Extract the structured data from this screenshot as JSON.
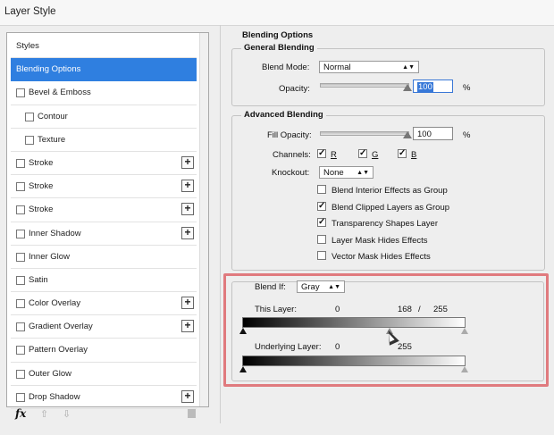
{
  "window": {
    "title": "Layer Style"
  },
  "sidebar": {
    "items": [
      {
        "label": "Styles",
        "checkbox": false,
        "selected": false,
        "indent": 0,
        "plus": false
      },
      {
        "label": "Blending Options",
        "checkbox": false,
        "selected": true,
        "indent": 0,
        "plus": false
      },
      {
        "label": "Bevel & Emboss",
        "checkbox": true,
        "selected": false,
        "indent": 0,
        "plus": false
      },
      {
        "label": "Contour",
        "checkbox": true,
        "selected": false,
        "indent": 1,
        "plus": false
      },
      {
        "label": "Texture",
        "checkbox": true,
        "selected": false,
        "indent": 1,
        "plus": false
      },
      {
        "label": "Stroke",
        "checkbox": true,
        "selected": false,
        "indent": 0,
        "plus": true
      },
      {
        "label": "Stroke",
        "checkbox": true,
        "selected": false,
        "indent": 0,
        "plus": true
      },
      {
        "label": "Stroke",
        "checkbox": true,
        "selected": false,
        "indent": 0,
        "plus": true
      },
      {
        "label": "Inner Shadow",
        "checkbox": true,
        "selected": false,
        "indent": 0,
        "plus": true
      },
      {
        "label": "Inner Glow",
        "checkbox": true,
        "selected": false,
        "indent": 0,
        "plus": false
      },
      {
        "label": "Satin",
        "checkbox": true,
        "selected": false,
        "indent": 0,
        "plus": false
      },
      {
        "label": "Color Overlay",
        "checkbox": true,
        "selected": false,
        "indent": 0,
        "plus": true
      },
      {
        "label": "Gradient Overlay",
        "checkbox": true,
        "selected": false,
        "indent": 0,
        "plus": true
      },
      {
        "label": "Pattern Overlay",
        "checkbox": true,
        "selected": false,
        "indent": 0,
        "plus": false
      },
      {
        "label": "Outer Glow",
        "checkbox": true,
        "selected": false,
        "indent": 0,
        "plus": false
      },
      {
        "label": "Drop Shadow",
        "checkbox": true,
        "selected": false,
        "indent": 0,
        "plus": true
      }
    ],
    "plus_glyph": "+",
    "bottom": {
      "fx": "fx",
      "up_arrow": "⇧",
      "down_arrow": "⇩"
    }
  },
  "blending": {
    "heading": "Blending Options",
    "general": {
      "title": "General Blending",
      "blend_mode_label": "Blend Mode:",
      "blend_mode_value": "Normal",
      "opacity_label": "Opacity:",
      "opacity_value": "100",
      "opacity_unit": "%"
    },
    "advanced": {
      "title": "Advanced Blending",
      "fill_opacity_label": "Fill Opacity:",
      "fill_opacity_value": "100",
      "fill_opacity_unit": "%",
      "channels_label": "Channels:",
      "channel_r": "R",
      "channel_g": "G",
      "channel_b": "B",
      "knockout_label": "Knockout:",
      "knockout_value": "None",
      "options": [
        {
          "label": "Blend Interior Effects as Group",
          "checked": false
        },
        {
          "label": "Blend Clipped Layers as Group",
          "checked": true
        },
        {
          "label": "Transparency Shapes Layer",
          "checked": true
        },
        {
          "label": "Layer Mask Hides Effects",
          "checked": false
        },
        {
          "label": "Vector Mask Hides Effects",
          "checked": false
        }
      ]
    },
    "blend_if": {
      "label": "Blend If:",
      "value": "Gray",
      "this_layer_label": "This Layer:",
      "this_layer_low": "0",
      "this_layer_mid": "168",
      "separator": "/",
      "this_layer_high": "255",
      "underlying_label": "Underlying Layer:",
      "underlying_low": "0",
      "underlying_high": "255"
    }
  },
  "colors": {
    "accent": "#2f7fe0",
    "highlight_box": "#e07a7e"
  },
  "glyphs": {
    "dropdown": "▲▼",
    "check": "✓"
  }
}
